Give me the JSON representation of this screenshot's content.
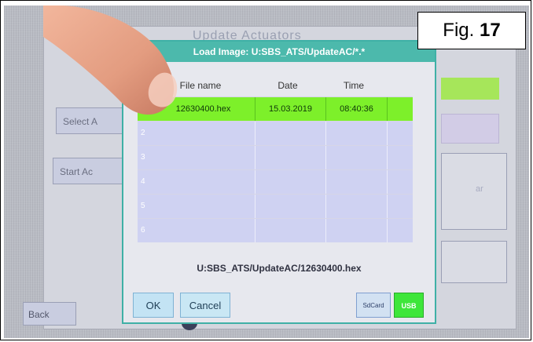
{
  "figure_label": {
    "prefix": "Fig.",
    "number": "17"
  },
  "background": {
    "title": "Update Actuators",
    "select_button": "Select A",
    "start_button": "Start Ac",
    "back_button": "Back"
  },
  "dialog": {
    "title": "Load Image: U:SBS_ATS/UpdateAC/*.*",
    "columns": [
      "File name",
      "Date",
      "Time"
    ],
    "rows": [
      {
        "index": "1",
        "file": "12630400.hex",
        "date": "15.03.2019",
        "time": "08:40:36"
      },
      {
        "index": "2",
        "file": "",
        "date": "",
        "time": ""
      },
      {
        "index": "3",
        "file": "",
        "date": "",
        "time": ""
      },
      {
        "index": "4",
        "file": "",
        "date": "",
        "time": ""
      },
      {
        "index": "5",
        "file": "",
        "date": "",
        "time": ""
      },
      {
        "index": "6",
        "file": "",
        "date": "",
        "time": ""
      }
    ],
    "selected_path": "U:SBS_ATS/UpdateAC/12630400.hex",
    "ok_label": "OK",
    "cancel_label": "Cancel",
    "sdcard_label": "SdCard",
    "usb_label": "USB"
  },
  "colors": {
    "header_teal": "#4cb9ac",
    "selected_row": "#7df02a",
    "empty_row": "#cfd2f2",
    "usb_active": "#3ee63a"
  }
}
